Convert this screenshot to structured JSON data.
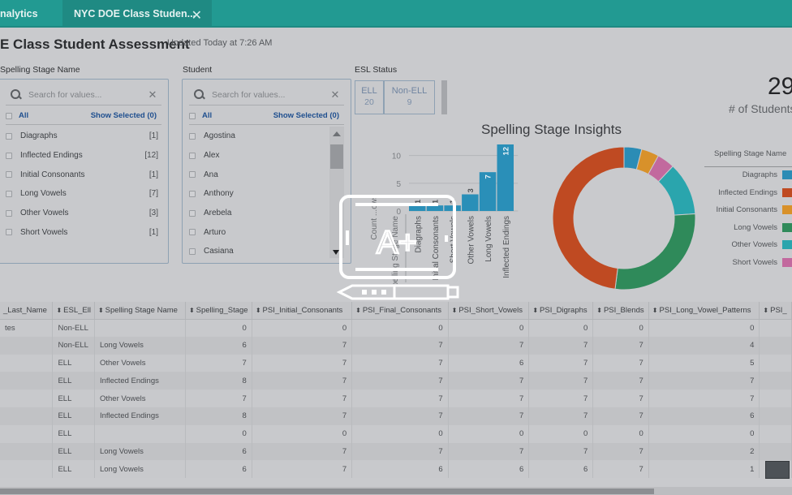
{
  "tabs": [
    {
      "label": "nalytics"
    },
    {
      "label": "NYC DOE Class Studen...",
      "close_icon": "close-icon",
      "active": true
    }
  ],
  "header": {
    "title": "E Class Student Assessment",
    "updated": "Updated Today at 7:26 AM"
  },
  "filters": {
    "spelling": {
      "label": "Spelling Stage Name",
      "placeholder": "Search for values...",
      "all_label": "All",
      "show_selected": "Show Selected (0)",
      "items": [
        {
          "label": "Diagraphs",
          "count": "[1]"
        },
        {
          "label": "Inflected Endings",
          "count": "[12]"
        },
        {
          "label": "Initial Consonants",
          "count": "[1]"
        },
        {
          "label": "Long Vowels",
          "count": "[7]"
        },
        {
          "label": "Other Vowels",
          "count": "[3]"
        },
        {
          "label": "Short Vowels",
          "count": "[1]"
        }
      ]
    },
    "student": {
      "label": "Student",
      "placeholder": "Search for values...",
      "all_label": "All",
      "show_selected": "Show Selected (0)",
      "items": [
        {
          "label": "Agostina"
        },
        {
          "label": "Alex"
        },
        {
          "label": "Ana"
        },
        {
          "label": "Anthony"
        },
        {
          "label": "Arebela"
        },
        {
          "label": "Arturo"
        },
        {
          "label": "Casiana"
        }
      ]
    },
    "esl": {
      "label": "ESL Status",
      "options": [
        {
          "label": "ELL",
          "value": "20"
        },
        {
          "label": "Non-ELL",
          "value": "9"
        }
      ]
    }
  },
  "kpi": {
    "value": "29",
    "label": "# of Students"
  },
  "chart_data": [
    {
      "type": "bar",
      "title": "Spelling Stage Insights",
      "xlabel": "Spelling Stage Name",
      "ylabel": "Count ...ows",
      "categories": [
        "Diagraphs",
        "Initial Consonants",
        "Short Vowels",
        "Other Vowels",
        "Long Vowels",
        "Inflected Endings"
      ],
      "values": [
        1,
        1,
        1,
        3,
        7,
        12
      ],
      "ylim": [
        0,
        12
      ],
      "yticks": [
        "0",
        "5",
        "10"
      ],
      "grid": true,
      "color": "#2a8fb8"
    },
    {
      "type": "pie",
      "donut": true,
      "legend_title": "Spelling Stage Name",
      "legend_position": "right",
      "categories": [
        "Diagraphs",
        "Initial Consonants",
        "Short Vowels",
        "Other Vowels",
        "Long Vowels",
        "Inflected Endings"
      ],
      "values": [
        1,
        1,
        1,
        3,
        7,
        12
      ],
      "colors": [
        "#2b8cb5",
        "#d8912a",
        "#c2699e",
        "#2aa5ad",
        "#2f8a5a",
        "#bf4a22"
      ],
      "legend": [
        {
          "label": "Diagraphs",
          "color": "#2b8cb5"
        },
        {
          "label": "Inflected Endings",
          "color": "#bf4a22"
        },
        {
          "label": "Initial Consonants",
          "color": "#d8912a"
        },
        {
          "label": "Long Vowels",
          "color": "#2f8a5a"
        },
        {
          "label": "Other Vowels",
          "color": "#2aa5ad"
        },
        {
          "label": "Short Vowels",
          "color": "#c2699e"
        }
      ]
    }
  ],
  "table": {
    "columns": [
      "_Last_Name",
      "ESL_Ell",
      "Spelling Stage Name",
      "Spelling_Stage",
      "PSI_Initial_Consonants",
      "PSI_Final_Consonants",
      "PSI_Short_Vowels",
      "PSI_Digraphs",
      "PSI_Blends",
      "PSI_Long_Vowel_Patterns",
      "PSI_"
    ],
    "rows": [
      [
        "tes",
        "Non-ELL",
        "",
        "0",
        "0",
        "0",
        "0",
        "0",
        "0",
        "0",
        ""
      ],
      [
        "",
        "Non-ELL",
        "Long Vowels",
        "6",
        "7",
        "7",
        "7",
        "7",
        "7",
        "4",
        ""
      ],
      [
        "",
        "ELL",
        "Other Vowels",
        "7",
        "7",
        "7",
        "6",
        "7",
        "7",
        "5",
        ""
      ],
      [
        "",
        "ELL",
        "Inflected Endings",
        "8",
        "7",
        "7",
        "7",
        "7",
        "7",
        "7",
        ""
      ],
      [
        "",
        "ELL",
        "Other Vowels",
        "7",
        "7",
        "7",
        "7",
        "7",
        "7",
        "7",
        ""
      ],
      [
        "",
        "ELL",
        "Inflected Endings",
        "8",
        "7",
        "7",
        "7",
        "7",
        "7",
        "6",
        ""
      ],
      [
        "",
        "ELL",
        "",
        "0",
        "0",
        "0",
        "0",
        "0",
        "0",
        "0",
        ""
      ],
      [
        "",
        "ELL",
        "Long Vowels",
        "6",
        "7",
        "7",
        "7",
        "7",
        "7",
        "2",
        ""
      ],
      [
        "",
        "ELL",
        "Long Vowels",
        "6",
        "7",
        "6",
        "6",
        "6",
        "7",
        "1",
        ""
      ]
    ]
  },
  "overlay": {
    "icon": "grade-a-plus-tablet-pencil-icon",
    "text": "A+"
  }
}
